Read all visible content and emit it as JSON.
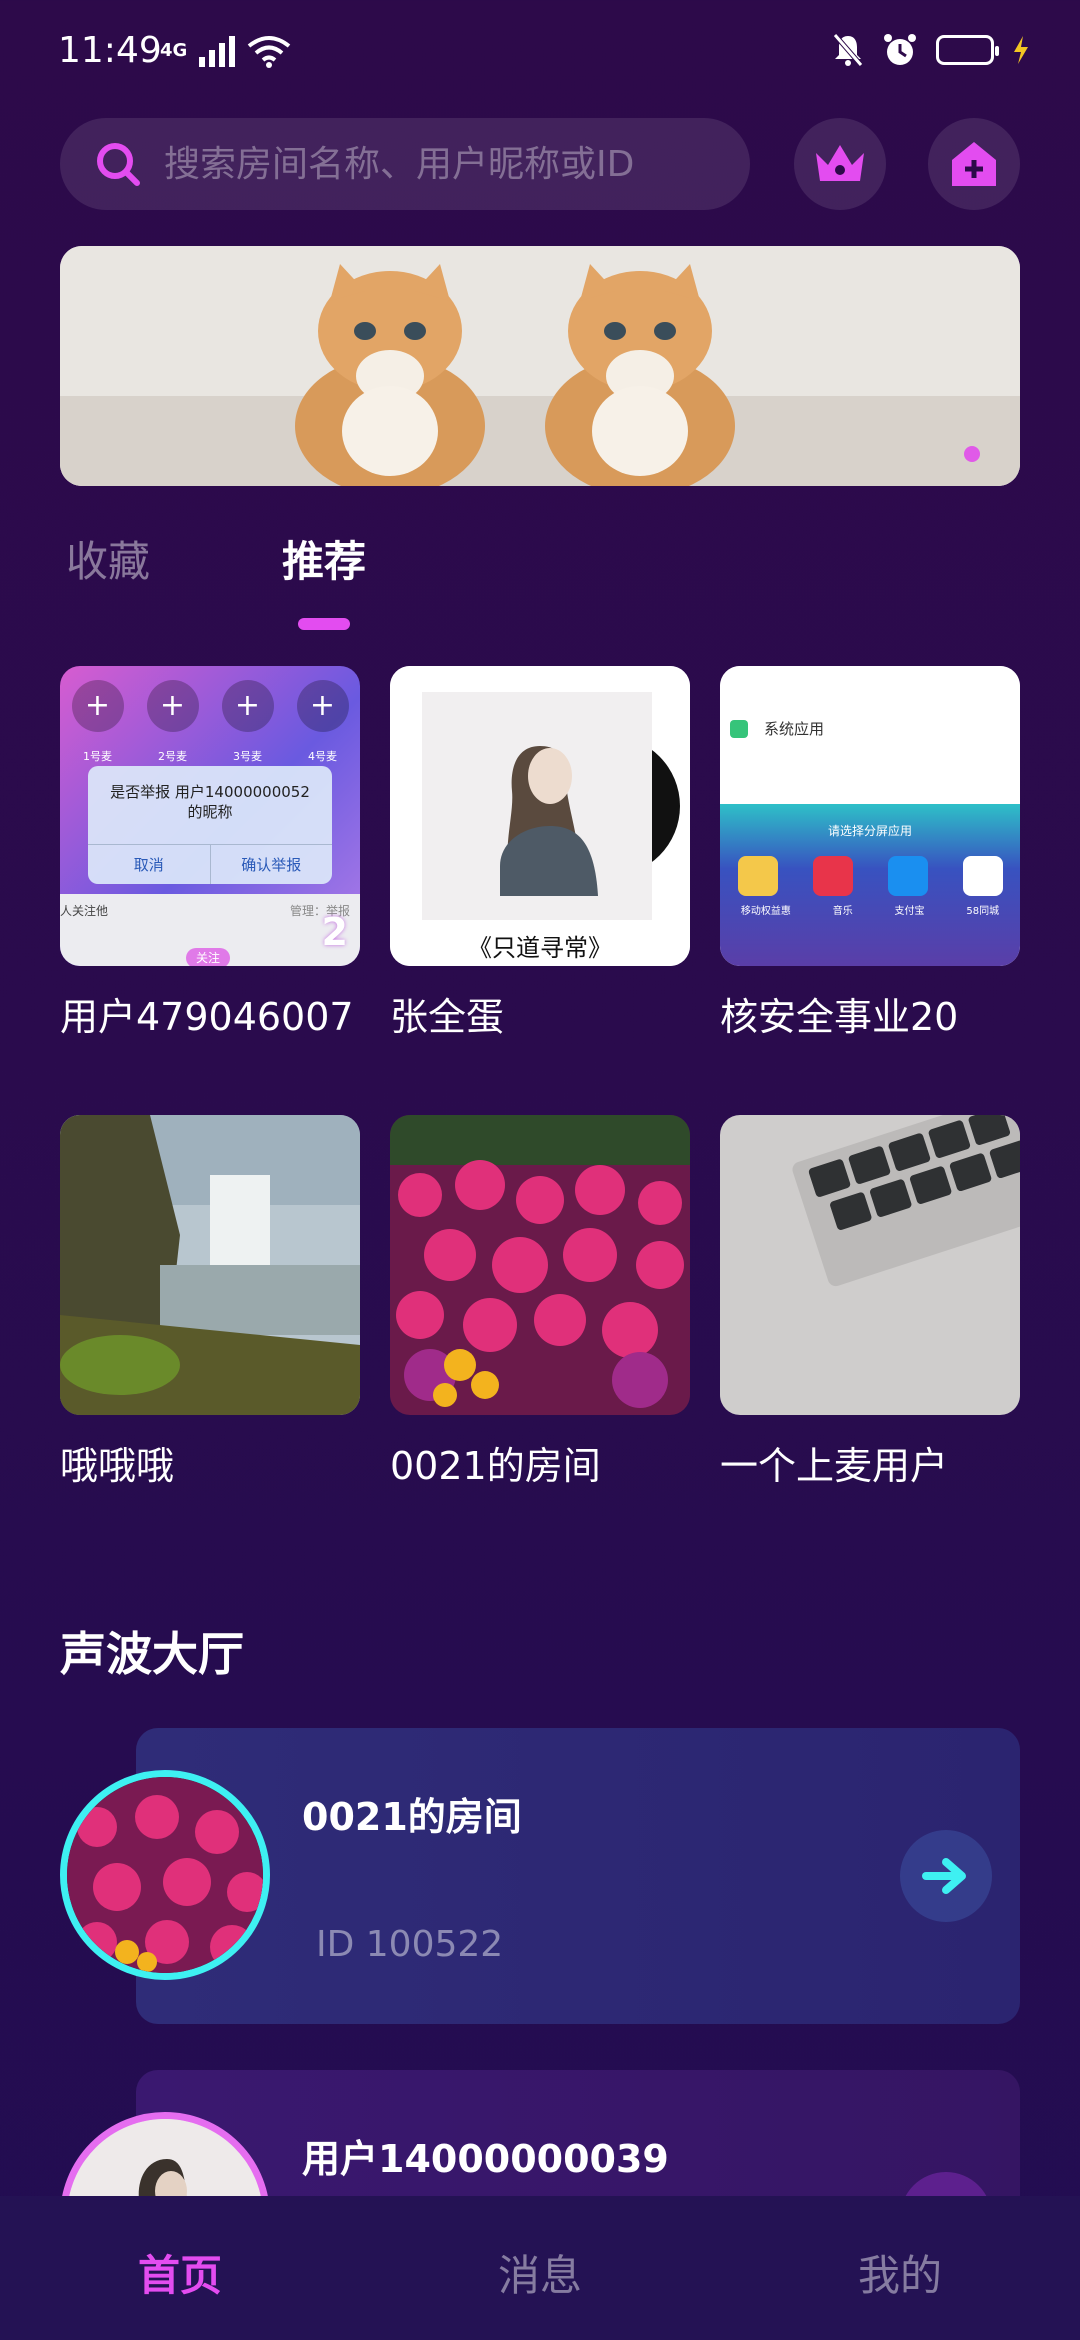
{
  "status": {
    "time": "11:49",
    "network": "4G"
  },
  "search": {
    "placeholder": "搜索房间名称、用户昵称或ID"
  },
  "tabs": [
    {
      "label": "收藏"
    },
    {
      "label": "推荐"
    }
  ],
  "rooms": [
    {
      "name": "用户479046007",
      "thumb": {
        "dialog_text": "是否举报 用户14000000052 的昵称",
        "cancel": "取消",
        "confirm": "确认举报",
        "seats": [
          "1号麦",
          "2号麦",
          "3号麦",
          "4号麦"
        ],
        "fans_text": "人关注他",
        "badge": "2",
        "follow": "关注",
        "admin": "管理：举报"
      }
    },
    {
      "name": "张全蛋",
      "thumb": {
        "caption": "《只道寻常》"
      }
    },
    {
      "name": "核安全事业20",
      "thumb": {
        "system_app": "系统应用",
        "split_hint": "请选择分屏应用",
        "apps": [
          "移动权益惠",
          "音乐",
          "支付宝",
          "58同城"
        ]
      }
    },
    {
      "name": "哦哦哦"
    },
    {
      "name": "0021的房间"
    },
    {
      "name": "一个上麦用户"
    }
  ],
  "hall": {
    "title": "声波大厅",
    "cards": [
      {
        "name": "0021的房间",
        "id_text": "ID 100522"
      },
      {
        "name": "用户14000000039"
      }
    ]
  },
  "nav": [
    {
      "label": "首页"
    },
    {
      "label": "消息"
    },
    {
      "label": "我的"
    }
  ],
  "colors": {
    "accent": "#e34cf0",
    "cyan": "#3ef0f2",
    "bg": "#2a0b4d"
  }
}
